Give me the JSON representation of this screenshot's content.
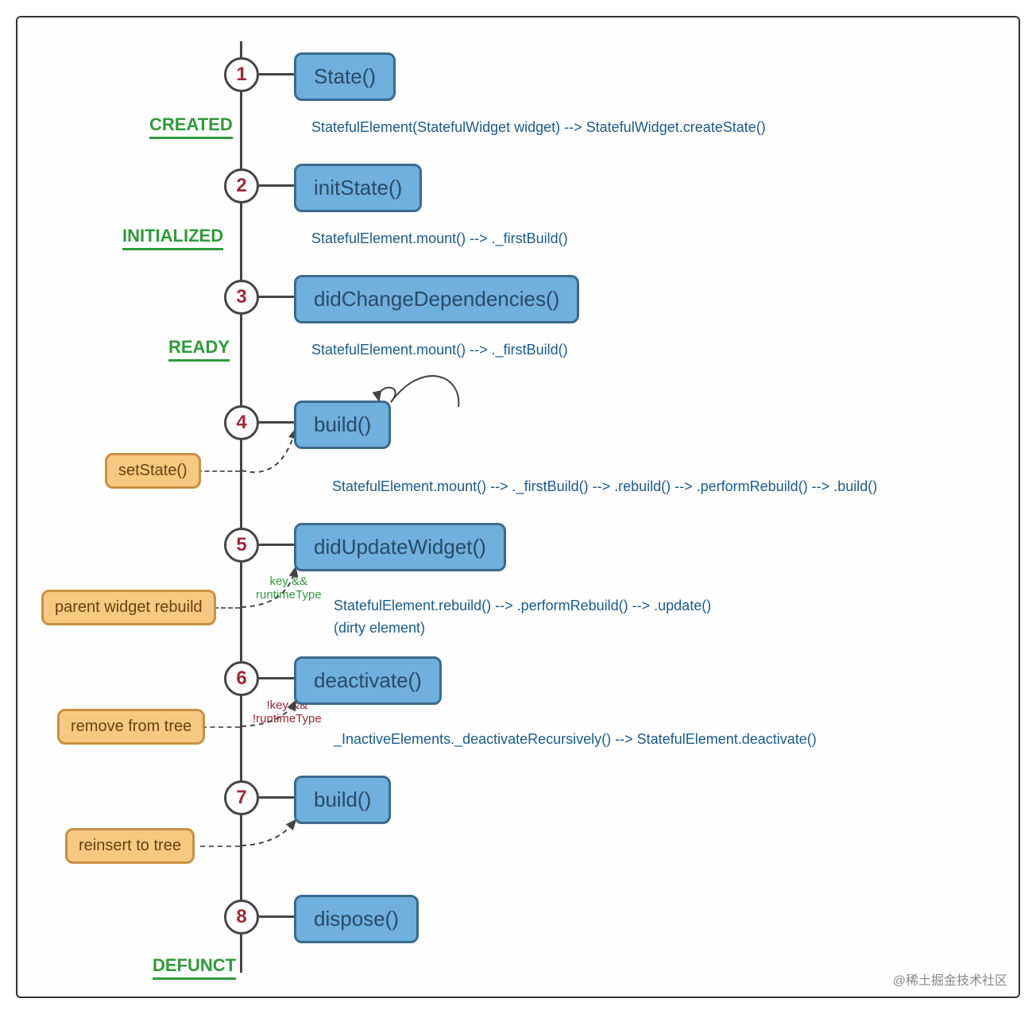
{
  "phases": {
    "created": "CREATED",
    "initialized": "INITIALIZED",
    "ready": "READY",
    "defunct": "DEFUNCT"
  },
  "steps": [
    {
      "num": "1",
      "method": "State()",
      "desc": "StatefulElement(StatefulWidget widget) --> StatefulWidget.createState()"
    },
    {
      "num": "2",
      "method": "initState()",
      "desc": "StatefulElement.mount() --> ._firstBuild()"
    },
    {
      "num": "3",
      "method": "didChangeDependencies()",
      "desc": "StatefulElement.mount() --> ._firstBuild()"
    },
    {
      "num": "4",
      "method": "build()",
      "desc": "StatefulElement.mount() --> ._firstBuild() -->  .rebuild() --> .performRebuild() --> .build()"
    },
    {
      "num": "5",
      "method": "didUpdateWidget()",
      "desc": "StatefulElement.rebuild() --> .performRebuild() --> .update()",
      "desc2": "(dirty element)"
    },
    {
      "num": "6",
      "method": "deactivate()",
      "desc": "_InactiveElements._deactivateRecursively() -->  StatefulElement.deactivate()"
    },
    {
      "num": "7",
      "method": "build()",
      "desc": ""
    },
    {
      "num": "8",
      "method": "dispose()",
      "desc": ""
    }
  ],
  "actions": {
    "setState": "setState()",
    "parentRebuild": "parent widget rebuild",
    "removeFromTree": "remove from tree",
    "reinsertToTree": "reinsert to tree"
  },
  "annotations": {
    "keyAndRuntime": "key &&\nruntimeType",
    "notKeyAndRuntime": "!key &&\n!runtimeType"
  },
  "watermark": "@稀土掘金技术社区"
}
